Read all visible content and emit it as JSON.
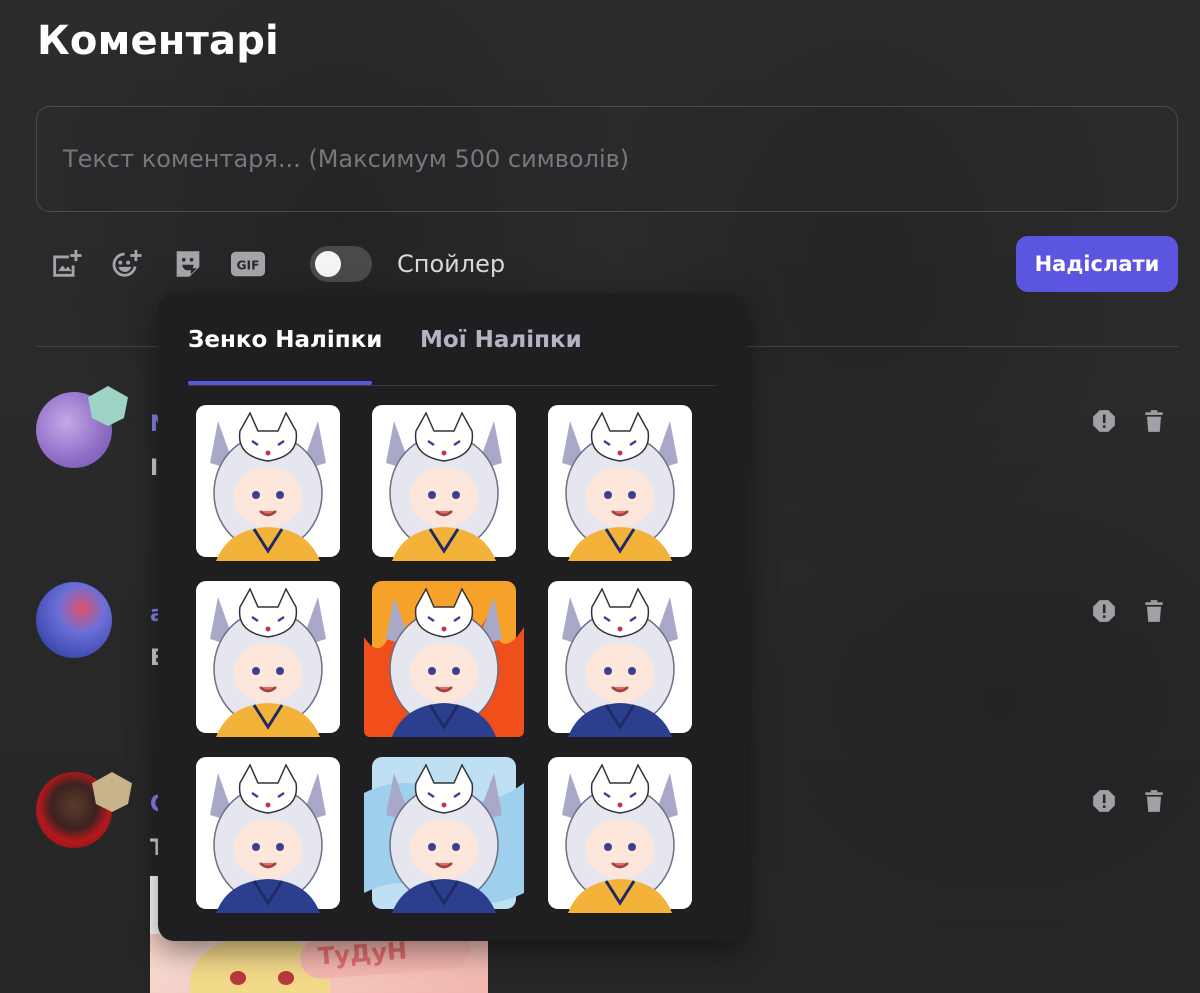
{
  "page": {
    "title": "Коментарі"
  },
  "composer": {
    "placeholder": "Текст коментаря... (Максимум 500 символів)",
    "toolbar_icons": [
      "add-image-icon",
      "add-emoji-icon",
      "sticker-icon",
      "gif-icon"
    ],
    "gif_label": "GIF",
    "spoiler_label": "Спойлер",
    "spoiler_on": false,
    "send_label": "Надіслати"
  },
  "sticker_picker": {
    "tabs": [
      {
        "label": "Зенко Наліпки",
        "active": true
      },
      {
        "label": "Мої Наліпки",
        "active": false
      }
    ],
    "stickers": [
      {
        "name": "fox-girl-angry",
        "hair": "#e6e6ef",
        "robe": "#f3b23a"
      },
      {
        "name": "fox-girl-crying",
        "hair": "#e6e6ef",
        "robe": "#f3b23a"
      },
      {
        "name": "fox-girl-waving",
        "hair": "#e6e6ef",
        "robe": "#f3b23a"
      },
      {
        "name": "fox-duo-hug",
        "hair": "#e6e6ef",
        "robe": "#f3b23a"
      },
      {
        "name": "fox-boy-fire-angry",
        "hair": "#e6e6ef",
        "robe": "#2c3f8f"
      },
      {
        "name": "fox-boy-waving",
        "hair": "#e6e6ef",
        "robe": "#2c3f8f"
      },
      {
        "name": "fox-boy-cheer",
        "hair": "#e6e6ef",
        "robe": "#2c3f8f"
      },
      {
        "name": "fox-boy-sad",
        "hair": "#e6e6ef",
        "robe": "#2c3f8f"
      },
      {
        "name": "fox-girl-sparkle",
        "hair": "#e6e6ef",
        "robe": "#f3b23a"
      }
    ]
  },
  "comments": [
    {
      "name": "N",
      "text": "I",
      "avatar_color": "#9b7fd1",
      "badge_color": "#9fd3c6"
    },
    {
      "name": "a",
      "text": "B",
      "avatar_color": "#5560c9",
      "badge_color": ""
    },
    {
      "name": "C",
      "text": "T",
      "avatar_color": "#8a2b2b",
      "badge_color": "#c9b38a",
      "image_caption": "ТуДуН"
    }
  ],
  "colors": {
    "accent": "#5b55e0",
    "background": "#2a2a2b",
    "popup": "#1f1f21"
  }
}
